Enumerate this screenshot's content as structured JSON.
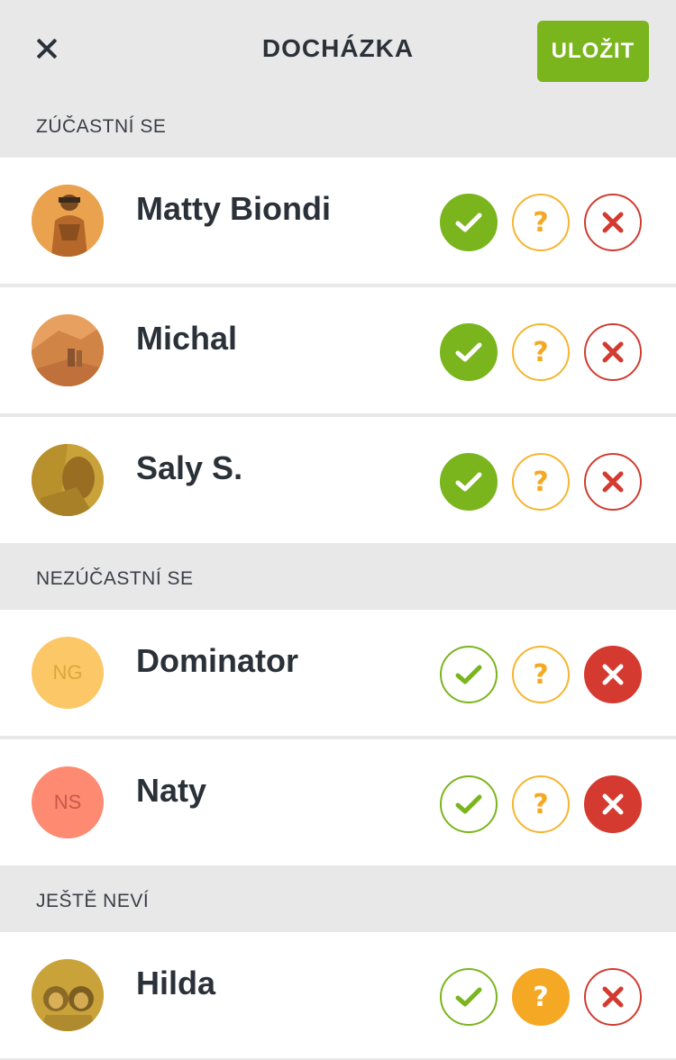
{
  "header": {
    "title": "DOCHÁZKA",
    "save_label": "ULOŽIT"
  },
  "sections": {
    "attending": "ZÚČASTNÍ SE",
    "not_attending": "NEZÚČASTNÍ SE",
    "undecided": "JEŠTĚ NEVÍ"
  },
  "members": [
    {
      "name": "Matty Biondi",
      "status": "yes",
      "avatar": "photo"
    },
    {
      "name": "Michal",
      "status": "yes",
      "avatar": "photo"
    },
    {
      "name": "Saly S.",
      "status": "yes",
      "avatar": "photo"
    },
    {
      "name": "Dominator",
      "status": "no",
      "initials": "NG",
      "avatar_color": "#fcc766",
      "initials_color": "#d9a73d"
    },
    {
      "name": "Naty",
      "status": "no",
      "initials": "NS",
      "avatar_color": "#ff8a72",
      "initials_color": "#c65a48"
    },
    {
      "name": "Hilda",
      "status": "maybe",
      "avatar": "photo"
    }
  ],
  "colors": {
    "accent_green": "#7ab51d",
    "maybe_orange": "#f5a823",
    "no_red": "#d43a30",
    "section_bg": "#e8e8e9"
  },
  "icons": {
    "yes": "check-icon",
    "maybe": "question-icon",
    "no": "x-icon"
  },
  "maybe_glyph": "?"
}
